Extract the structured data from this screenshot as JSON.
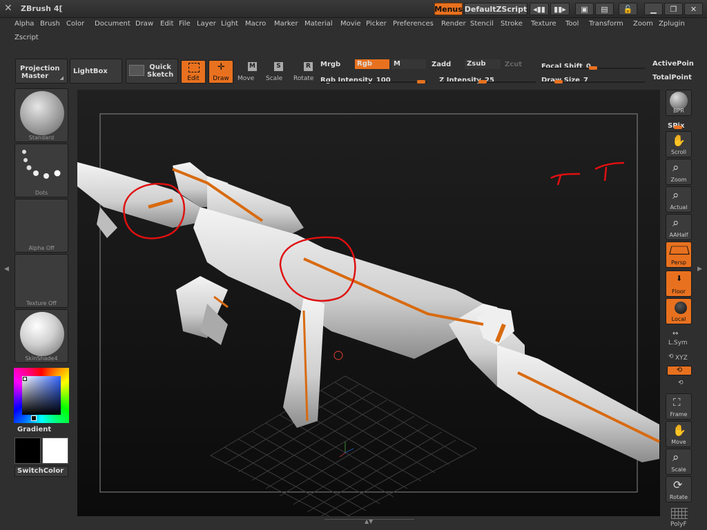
{
  "app": {
    "title": "ZBrush 4["
  },
  "titlebar": {
    "menus_label": "Menus",
    "script_label": "DefaultZScript"
  },
  "menus": [
    "Alpha",
    "Brush",
    "Color",
    "Document",
    "Draw",
    "Edit",
    "File",
    "Layer",
    "Light",
    "Macro",
    "Marker",
    "Material",
    "Movie",
    "Picker",
    "Preferences",
    "Render",
    "Stencil",
    "Stroke",
    "Texture",
    "Tool",
    "Transform",
    "Zoom",
    "Zplugin",
    "Zscript"
  ],
  "shelf": {
    "projection_master": [
      "Projection",
      "Master"
    ],
    "lightbox": "LightBox",
    "quick_sketch": [
      "Quick",
      "Sketch"
    ],
    "edit": "Edit",
    "draw": "Draw",
    "move": "Move",
    "scale": "Scale",
    "rotate": "Rotate",
    "mrgb": "Mrgb",
    "rgb": "Rgb",
    "m": "M",
    "zadd": "Zadd",
    "zsub": "Zsub",
    "zcut": "Zcut",
    "rgb_intensity_label": "Rgb Intensity",
    "rgb_intensity": "100",
    "z_intensity_label": "Z Intensity",
    "z_intensity": "25",
    "focal_shift_label": "Focal Shift",
    "focal_shift": "0",
    "draw_size_label": "Draw Size",
    "draw_size": "7",
    "active_points": "ActivePoin",
    "total_points": "TotalPoint"
  },
  "left": {
    "brush": "Standard",
    "stroke": "Dots",
    "alpha": "Alpha  Off",
    "texture": "Texture  Off",
    "material": "SkinShade4",
    "gradient": "Gradient",
    "switchcolor": "SwitchColor"
  },
  "right": {
    "bpr": "BPR",
    "spix": "SPix",
    "scroll": "Scroll",
    "zoom": "Zoom",
    "actual": "Actual",
    "aahalf": "AAHalf",
    "persp": "Persp",
    "floor": "Floor",
    "local": "Local",
    "lsym": "L.Sym",
    "xyz": "XYZ",
    "frame": "Frame",
    "move": "Move",
    "scale": "Scale",
    "rotate": "Rotate",
    "polyf": "PolyF"
  },
  "colors": {
    "accent": "#e8711f",
    "annotation": "#e01010"
  }
}
